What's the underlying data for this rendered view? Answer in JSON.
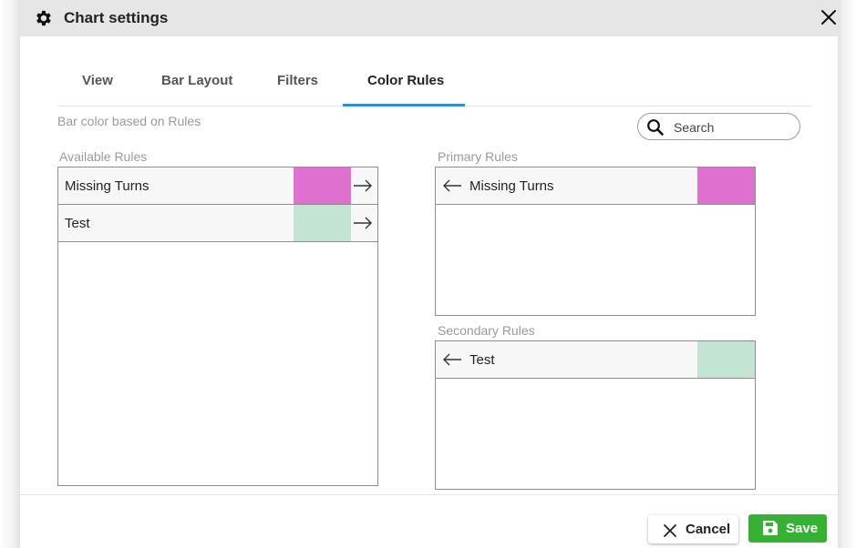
{
  "dialog": {
    "title": "Chart settings"
  },
  "tabs": [
    {
      "label": "View",
      "active": false
    },
    {
      "label": "Bar Layout",
      "active": false
    },
    {
      "label": "Filters",
      "active": false
    },
    {
      "label": "Color Rules",
      "active": true
    }
  ],
  "subtitle": "Bar color based on Rules",
  "search": {
    "placeholder": "Search",
    "value": ""
  },
  "available": {
    "label": "Available Rules",
    "rules": [
      {
        "name": "Missing Turns",
        "color": "#e070cf"
      },
      {
        "name": "Test",
        "color": "#c3e4d3"
      }
    ]
  },
  "primary": {
    "label": "Primary Rules",
    "rules": [
      {
        "name": "Missing Turns",
        "color": "#e070cf"
      }
    ]
  },
  "secondary": {
    "label": "Secondary Rules",
    "rules": [
      {
        "name": "Test",
        "color": "#c3e4d3"
      }
    ]
  },
  "footer": {
    "cancel_label": "Cancel",
    "save_label": "Save"
  },
  "colors": {
    "accent": "#2a8fd6",
    "save": "#35b233",
    "titlebar": "#e6e6e6"
  },
  "icons": {
    "title": "gear-icon",
    "close": "close-icon",
    "search": "search-icon",
    "move_right": "arrow-right-icon",
    "move_left": "arrow-left-icon",
    "cancel": "close-icon",
    "save": "floppy-disk-icon"
  }
}
